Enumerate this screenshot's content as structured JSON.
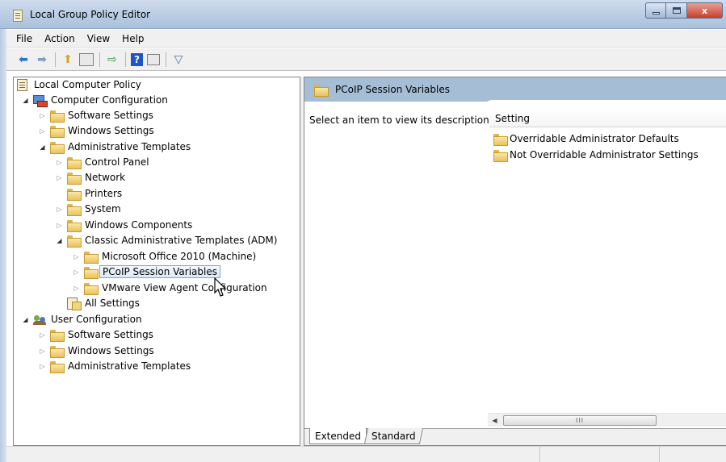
{
  "window": {
    "title": "Local Group Policy Editor",
    "close_glyph": "x"
  },
  "menu": [
    "File",
    "Action",
    "View",
    "Help"
  ],
  "toolbar": {
    "icons": [
      "back-icon",
      "forward-icon",
      "up-folder-icon",
      "show-hide-tree-icon",
      "export-icon",
      "help-icon",
      "properties-icon",
      "filter-icon"
    ],
    "help_glyph": "?"
  },
  "tree": {
    "root": "Local Computer Policy",
    "computer_configuration": "Computer Configuration",
    "cc_software_settings": "Software Settings",
    "cc_windows_settings": "Windows Settings",
    "cc_admin_templates": "Administrative Templates",
    "control_panel": "Control Panel",
    "network": "Network",
    "printers": "Printers",
    "system": "System",
    "windows_components": "Windows Components",
    "classic_admin_templates": "Classic Administrative Templates (ADM)",
    "ms_office": "Microsoft Office 2010 (Machine)",
    "pcoip": "PCoIP Session Variables",
    "vmware": "VMware View Agent Configuration",
    "all_settings": "All Settings",
    "user_configuration": "User Configuration",
    "uc_software_settings": "Software Settings",
    "uc_windows_settings": "Windows Settings",
    "uc_admin_templates": "Administrative Templates"
  },
  "details": {
    "header": "PCoIP Session Variables",
    "description": "Select an item to view its description.",
    "column": "Setting",
    "items": [
      "Overridable Administrator Defaults",
      "Not Overridable Administrator Settings"
    ],
    "scroll_grip": "III"
  },
  "tabs": [
    "Extended",
    "Standard"
  ],
  "colors": {
    "header_bg": "#a5bed6",
    "selection_border": "#7da2ce"
  }
}
